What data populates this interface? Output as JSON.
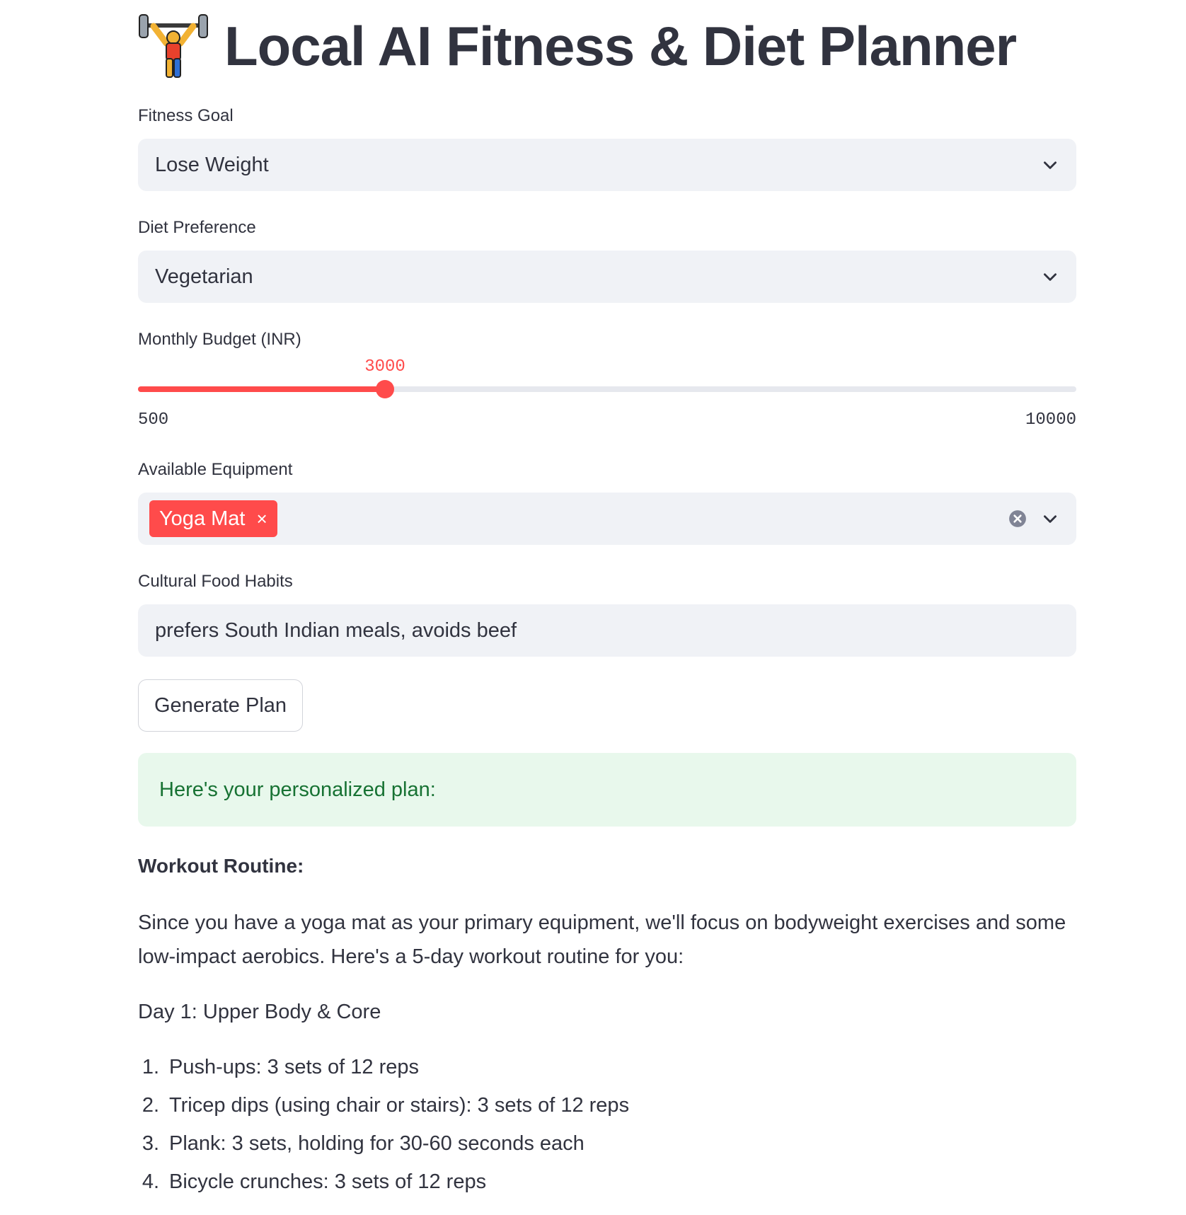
{
  "header": {
    "icon": "weightlifter-emoji-icon",
    "title": "Local AI Fitness & Diet Planner"
  },
  "fitness_goal": {
    "label": "Fitness Goal",
    "value": "Lose Weight"
  },
  "diet_preference": {
    "label": "Diet Preference",
    "value": "Vegetarian"
  },
  "budget": {
    "label": "Monthly Budget (INR)",
    "value": 3000,
    "value_text": "3000",
    "min": 500,
    "min_text": "500",
    "max": 10000,
    "max_text": "10000"
  },
  "equipment": {
    "label": "Available Equipment",
    "selected": [
      "Yoga Mat"
    ],
    "tag_remove_glyph": "×"
  },
  "cultural": {
    "label": "Cultural Food Habits",
    "value": "prefers South Indian meals, avoids beef"
  },
  "generate_button": {
    "label": "Generate Plan"
  },
  "success_message": "Here's your personalized plan:",
  "plan": {
    "heading": "Workout Routine:",
    "intro": "Since you have a yoga mat as your primary equipment, we'll focus on bodyweight exercises and some low-impact aerobics. Here's a 5-day workout routine for you:",
    "day1_title": "Day 1: Upper Body & Core",
    "day1_items": [
      {
        "num": "1.",
        "text": "Push-ups: 3 sets of 12 reps"
      },
      {
        "num": "2.",
        "text": "Tricep dips (using chair or stairs): 3 sets of 12 reps"
      },
      {
        "num": "3.",
        "text": "Plank: 3 sets, holding for 30-60 seconds each"
      },
      {
        "num": "4.",
        "text": "Bicycle crunches: 3 sets of 12 reps"
      }
    ]
  },
  "colors": {
    "accent": "#ff4b4b",
    "input_bg": "#f0f2f6",
    "success_bg": "#e8f8ec",
    "success_text": "#177233",
    "text": "#31333f"
  }
}
